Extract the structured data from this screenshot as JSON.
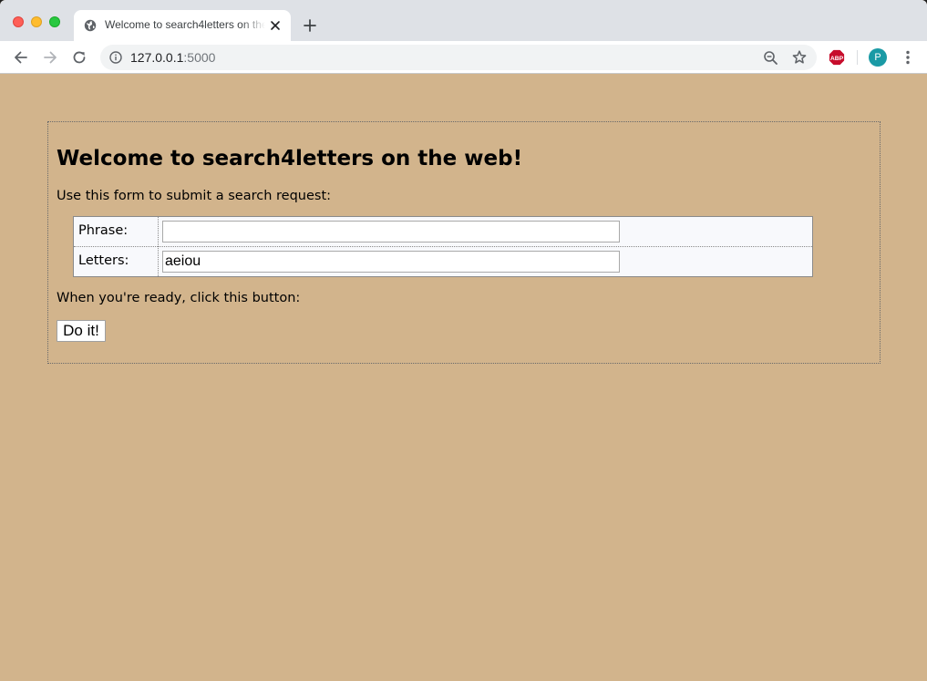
{
  "browser": {
    "tab": {
      "title": "Welcome to search4letters on the web!",
      "favicon": "globe-icon",
      "close_icon": "close-icon"
    },
    "new_tab_icon": "plus-icon",
    "toolbar": {
      "back_icon": "arrow-left-icon",
      "forward_icon": "arrow-right-icon",
      "reload_icon": "reload-icon",
      "address": {
        "info_icon": "info-icon",
        "host": "127.0.0.1",
        "port": ":5000",
        "zoom_icon": "zoom-out-icon",
        "bookmark_icon": "star-icon"
      },
      "extension_label": "ABP",
      "profile_initial": "P",
      "menu_icon": "kebab-menu-icon"
    }
  },
  "page": {
    "background_color": "#d2b48c",
    "heading": "Welcome to search4letters on the web!",
    "intro": "Use this form to submit a search request:",
    "form": {
      "phrase_label": "Phrase:",
      "phrase_value": "",
      "letters_label": "Letters:",
      "letters_value": "aeiou"
    },
    "prompt": "When you're ready, click this button:",
    "submit_label": "Do it!"
  }
}
